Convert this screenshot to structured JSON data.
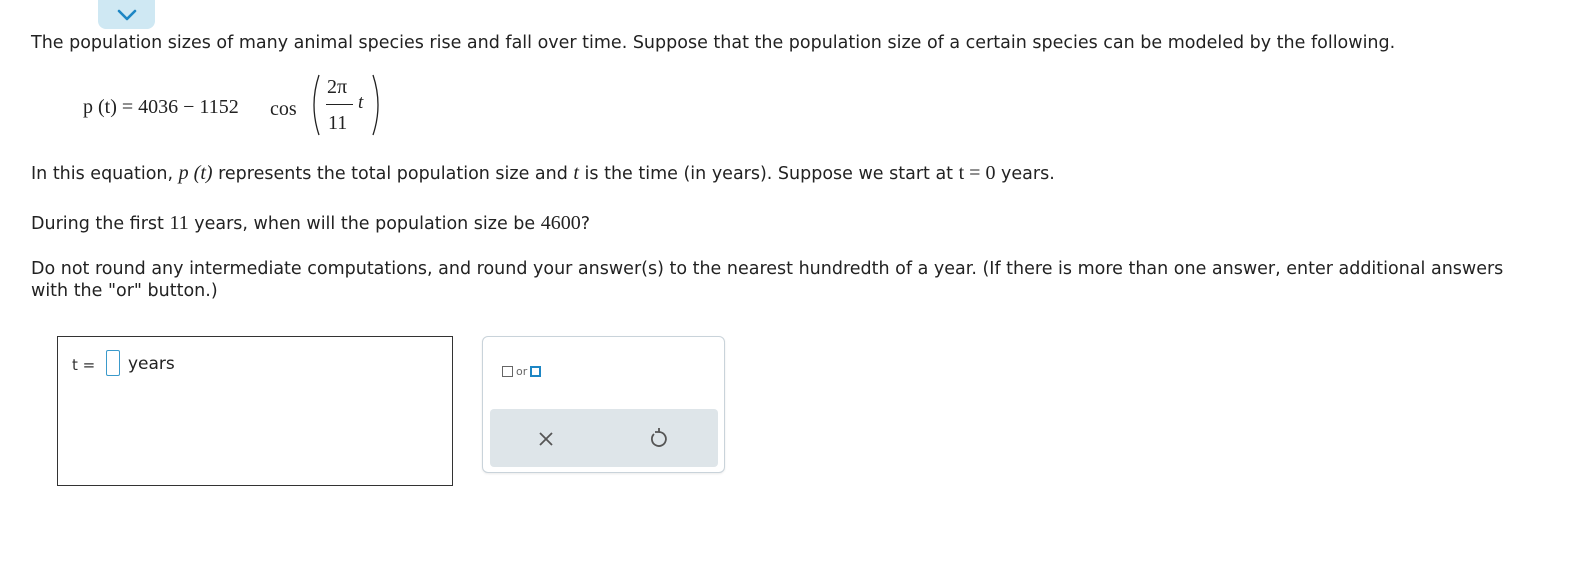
{
  "intro_text": "The population sizes of many animal species rise and fall over time. Suppose that the population size of a certain species can be modeled by the following.",
  "formula": {
    "lhs": "p (t) = 4036 − 1152",
    "cos": "cos",
    "numerator": "2π",
    "denominator": "11",
    "variable": "t"
  },
  "question": {
    "part1": "In this equation, ",
    "func": "p (t)",
    "part2": " represents the total population size and ",
    "t": "t",
    "part3": " is the time (in years). Suppose we start at ",
    "start": "t = 0",
    "part4": " years."
  },
  "question2": {
    "part1": "During the first ",
    "years": "11",
    "part2": " years, when will the population size be ",
    "target": "4600",
    "part3": "?"
  },
  "instructions": "Do not round any intermediate computations, and round your answer(s) to the nearest hundredth of a year. (If there is more than one answer, enter additional answers with the \"or\" button.)",
  "answer": {
    "label": "t =",
    "value": "",
    "units": "years"
  },
  "tools": {
    "or_label": "or",
    "clear_icon": "x-icon",
    "undo_icon": "undo-icon"
  },
  "colors": {
    "accent": "#1d86c4",
    "input_border": "#3b9acb",
    "toolbar_bg": "#dee5e9",
    "tab_bg": "#cfe8f3"
  }
}
